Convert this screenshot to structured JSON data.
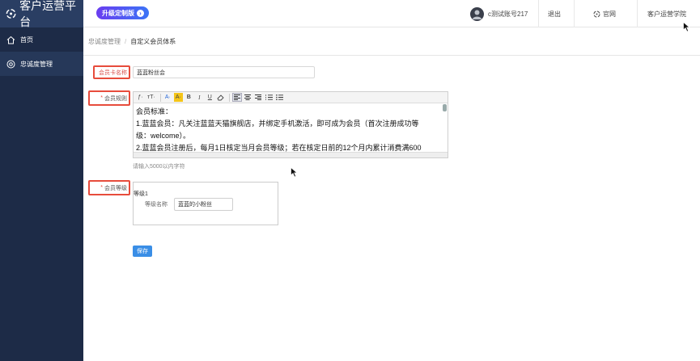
{
  "app": {
    "title": "客户运营平台"
  },
  "sidebar": {
    "items": [
      {
        "label": "首页",
        "icon": "home-icon"
      },
      {
        "label": "忠诚度管理",
        "icon": "loyalty-icon"
      }
    ]
  },
  "header": {
    "upgrade_label": "升级定制版",
    "user_name": "c测试账号217",
    "logout": "退出",
    "official_site": "官网",
    "academy": "客户运营学院"
  },
  "breadcrumb": {
    "parent": "忠诚度管理",
    "current": "自定义会员体系"
  },
  "form": {
    "card_name_label": "会员卡名称",
    "card_name_value": "蓝蓝粉丝会",
    "rules_label": "会员规则",
    "required_mark": "*",
    "rules_lines": [
      "会员标准：",
      "1.蓝蓝会员：凡关注蓝蓝天猫旗舰店，并绑定手机激活，即可成为会员（首次注册成功等",
      "级：welcome）。",
      "2.蓝蓝会员注册后，每月1日核定当月会员等级；若在核定日前的12个月内累计消费满600"
    ],
    "rules_hint": "请输入5000以内字符",
    "level_label": "会员等级",
    "level_title": "等级1",
    "level_name_label": "等级名称",
    "level_name_value": "蓝蓝的小粉丝",
    "save_label": "保存"
  },
  "toolbar": {
    "font_family": "ƒ·",
    "font_size": "тT·",
    "font_color": "A·",
    "bg_color": "A·",
    "bold": "B",
    "italic": "I",
    "underline": "U"
  },
  "colors": {
    "sidebar_bg": "#1d2b47",
    "accent": "#3a8ee6",
    "highlight": "#e74c3c"
  }
}
